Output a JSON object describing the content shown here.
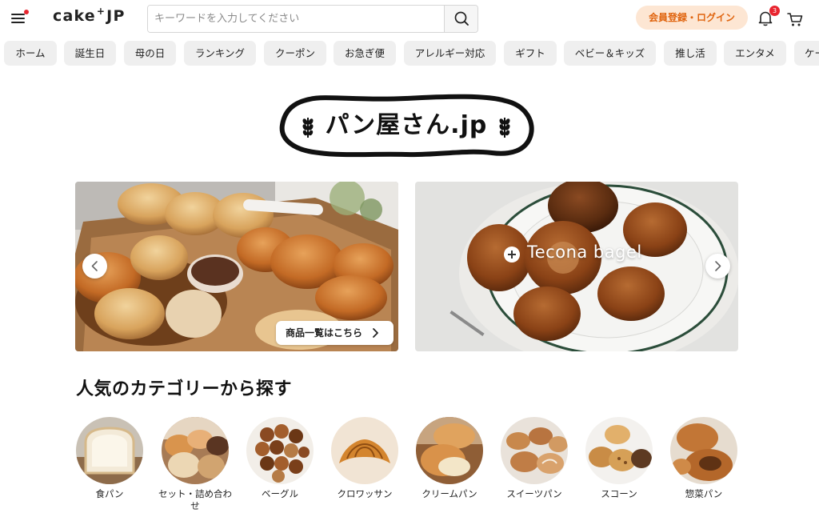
{
  "header": {
    "logo_text": "cake",
    "logo_plus": "+",
    "logo_suffix": "JP",
    "search_placeholder": "キーワードを入力してください",
    "login_label": "会員登録・ログイン",
    "notification_count": "3",
    "icons": {
      "menu": "hamburger-icon",
      "search": "search-icon",
      "bell": "bell-icon",
      "cart": "cart-icon"
    },
    "colors": {
      "accent": "#e0640e",
      "login_bg": "#fde6d3",
      "badge": "#e8242e"
    }
  },
  "nav": {
    "items": [
      "ホーム",
      "誕生日",
      "母の日",
      "ランキング",
      "クーポン",
      "お急ぎ便",
      "アレルギー対応",
      "ギフト",
      "ベビー＆キッズ",
      "推し活",
      "エンタメ",
      "ケーキ"
    ]
  },
  "brand": {
    "title": "パン屋さん.jp"
  },
  "carousel": {
    "view_all_label": "商品一覧はこちら",
    "slide_b_label": "Tecona bagel"
  },
  "categories": {
    "title": "人気のカテゴリーから探す",
    "items": [
      {
        "label": "食パン",
        "icon": "bread-loaf-image"
      },
      {
        "label": "セット・詰め合わせ",
        "icon": "bread-set-image"
      },
      {
        "label": "ベーグル",
        "icon": "bagel-image"
      },
      {
        "label": "クロワッサン",
        "icon": "croissant-image"
      },
      {
        "label": "クリームパン",
        "icon": "cream-bun-image"
      },
      {
        "label": "スイーツパン",
        "icon": "sweet-bread-image"
      },
      {
        "label": "スコーン",
        "icon": "scone-image"
      },
      {
        "label": "惣菜パン",
        "icon": "savory-bread-image"
      }
    ]
  }
}
